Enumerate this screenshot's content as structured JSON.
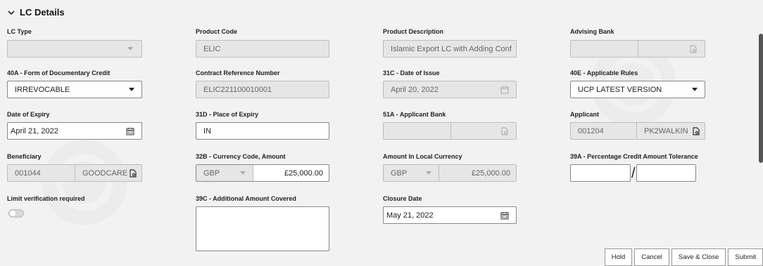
{
  "section": {
    "title": "LC Details"
  },
  "fields": {
    "lc_type": {
      "label": "LC Type",
      "value": ""
    },
    "product_code": {
      "label": "Product Code",
      "value": "ELIC"
    },
    "product_description": {
      "label": "Product Description",
      "value": "Islamic Export LC with Adding Conf"
    },
    "advising_bank": {
      "label": "Advising Bank",
      "value": ""
    },
    "form_of_credit": {
      "label": "40A - Form of Documentary Credit",
      "value": "IRREVOCABLE"
    },
    "contract_ref": {
      "label": "Contract Reference Number",
      "value": "ELIC221100010001"
    },
    "date_of_issue": {
      "label": "31C - Date of Issue",
      "value": "April 20, 2022"
    },
    "applicable_rules": {
      "label": "40E - Applicable Rules",
      "value": "UCP LATEST VERSION"
    },
    "date_of_expiry": {
      "label": "Date of Expiry",
      "value": "April 21, 2022"
    },
    "place_of_expiry": {
      "label": "31D - Place of Expiry",
      "value": "IN"
    },
    "applicant_bank": {
      "label": "51A - Applicant Bank",
      "value": ""
    },
    "applicant": {
      "label": "Applicant",
      "id": "001204",
      "name": "PK2WALKIN"
    },
    "beneficiary": {
      "label": "Beneficiary",
      "id": "001044",
      "name": "GOODCARE"
    },
    "currency_amount": {
      "label": "32B - Currency Code, Amount",
      "currency": "GBP",
      "amount": "£25,000.00"
    },
    "local_amount": {
      "label": "Amount In Local Currency",
      "currency": "GBP",
      "amount": "£25,000.00"
    },
    "tolerance": {
      "label": "39A - Percentage Credit Amount Tolerance",
      "separator": "/"
    },
    "limit_verification": {
      "label": "Limit verification required",
      "state": "off"
    },
    "additional_amount": {
      "label": "39C - Additional Amount Covered",
      "value": ""
    },
    "closure_date": {
      "label": "Closure Date",
      "value": "May 21, 2022"
    }
  },
  "buttons": {
    "hold": "Hold",
    "cancel": "Cancel",
    "save_close": "Save & Close",
    "submit": "Submit"
  }
}
